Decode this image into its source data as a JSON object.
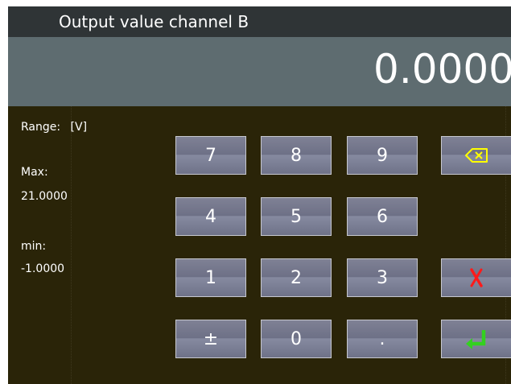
{
  "title": "Output value channel B",
  "display": {
    "value": "0.0000"
  },
  "info": {
    "range_label": "Range:",
    "range_unit": "[V]",
    "max_label": "Max:",
    "max_value": "21.0000",
    "min_label": "min:",
    "min_value": "-1.0000"
  },
  "keypad": {
    "key_7": "7",
    "key_8": "8",
    "key_9": "9",
    "key_4": "4",
    "key_5": "5",
    "key_6": "6",
    "key_1": "1",
    "key_2": "2",
    "key_3": "3",
    "key_plusminus": "±",
    "key_0": "0",
    "key_decimal": ".",
    "backspace_icon": "backspace-icon",
    "cancel_icon": "cancel-x-icon",
    "enter_icon": "enter-return-icon"
  },
  "colors": {
    "background": "#2a2408",
    "title_bar": "#2f3436",
    "value_bar": "#5e6c70",
    "key_face": "#7f8195",
    "backspace_yellow": "#ffff00",
    "cancel_red": "#ff1a1a",
    "enter_green": "#33d11f"
  }
}
